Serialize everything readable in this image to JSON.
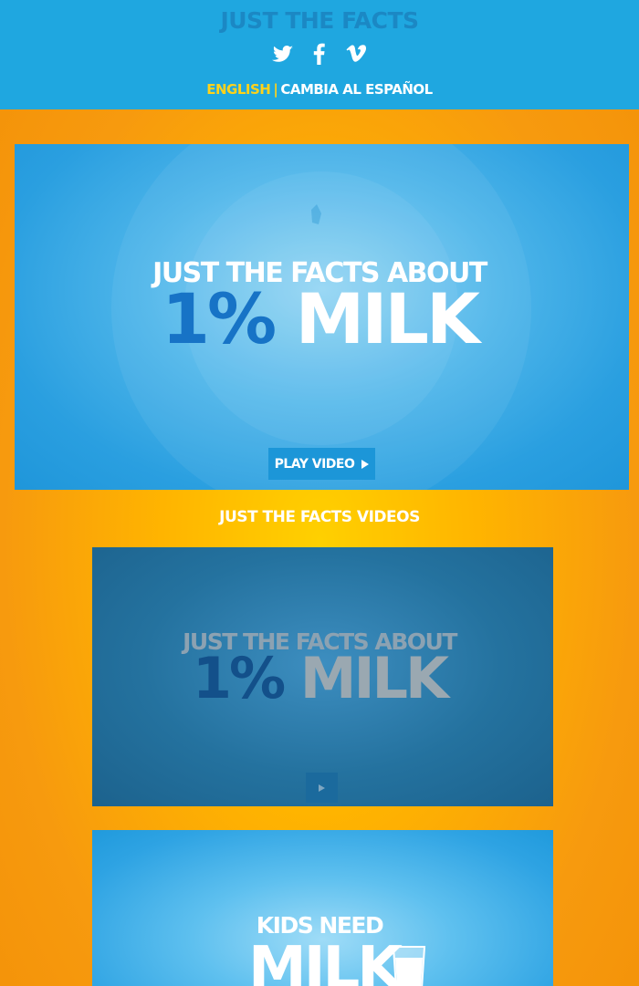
{
  "header": {
    "site_title": "JUST THE FACTS",
    "social": [
      {
        "icon": "twitter-icon"
      },
      {
        "icon": "facebook-icon"
      },
      {
        "icon": "vimeo-icon"
      }
    ],
    "lang_english": "ENGLISH",
    "lang_separator": "|",
    "lang_spanish": "CAMBIA AL ESPAÑOL"
  },
  "hero": {
    "line1": "JUST THE FACTS ABOUT",
    "percent": "1%",
    "milk": "MILK",
    "play_label": "PLAY VIDEO"
  },
  "videos": {
    "section_title": "JUST THE FACTS VIDEOS",
    "card1": {
      "line1": "JUST THE FACTS ABOUT",
      "percent": "1%",
      "milk": "MILK"
    },
    "card2": {
      "line1": "KIDS NEED",
      "line2": "MILK"
    }
  },
  "colors": {
    "header_bg": "#1fa7e0",
    "accent_yellow": "#ffd21b",
    "page_orange": "#f39108",
    "hero_blue": "#2a9fe0"
  }
}
